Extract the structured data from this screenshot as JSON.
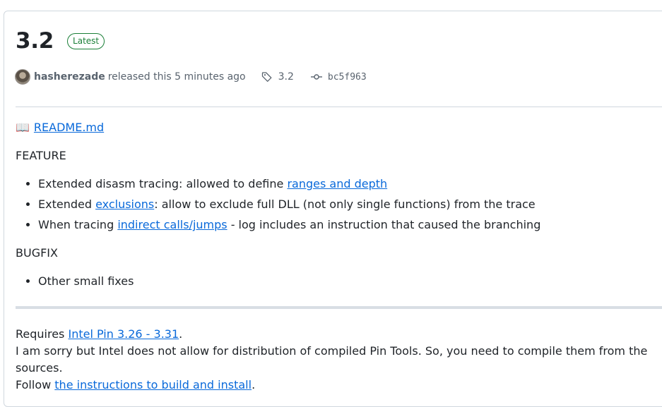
{
  "release": {
    "version": "3.2",
    "badge": "Latest",
    "author": "hasherezade",
    "released_text": "released this 5 minutes ago",
    "tag": "3.2",
    "commit": "bc5f963"
  },
  "body": {
    "readme_icon": "📖",
    "readme_link": "README.md",
    "feature_heading": "FEATURE",
    "features": [
      {
        "pre": "Extended disasm tracing: allowed to define ",
        "link": "ranges and depth",
        "post": ""
      },
      {
        "pre": "Extended ",
        "link": "exclusions",
        "post": ": allow to exclude full DLL (not only single functions) from the trace"
      },
      {
        "pre": "When tracing ",
        "link": "indirect calls/jumps",
        "post": " - log includes an instruction that caused the branching"
      }
    ],
    "bugfix_heading": "BUGFIX",
    "bugfixes": [
      "Other small fixes"
    ]
  },
  "footer": {
    "requires_pre": "Requires ",
    "requires_link": "Intel Pin 3.26 - 3.31",
    "requires_post": ".",
    "sorry_text": "I am sorry but Intel does not allow for distribution of compiled Pin Tools. So, you need to compile them from the sources.",
    "follow_pre": "Follow ",
    "follow_link": "the instructions to build and install",
    "follow_post": "."
  },
  "icons": {
    "tag": "tag-icon",
    "commit": "git-commit-icon",
    "readme": "book-icon"
  },
  "colors": {
    "link": "#0969da",
    "badge": "#1a7f37",
    "muted": "#59636e"
  }
}
